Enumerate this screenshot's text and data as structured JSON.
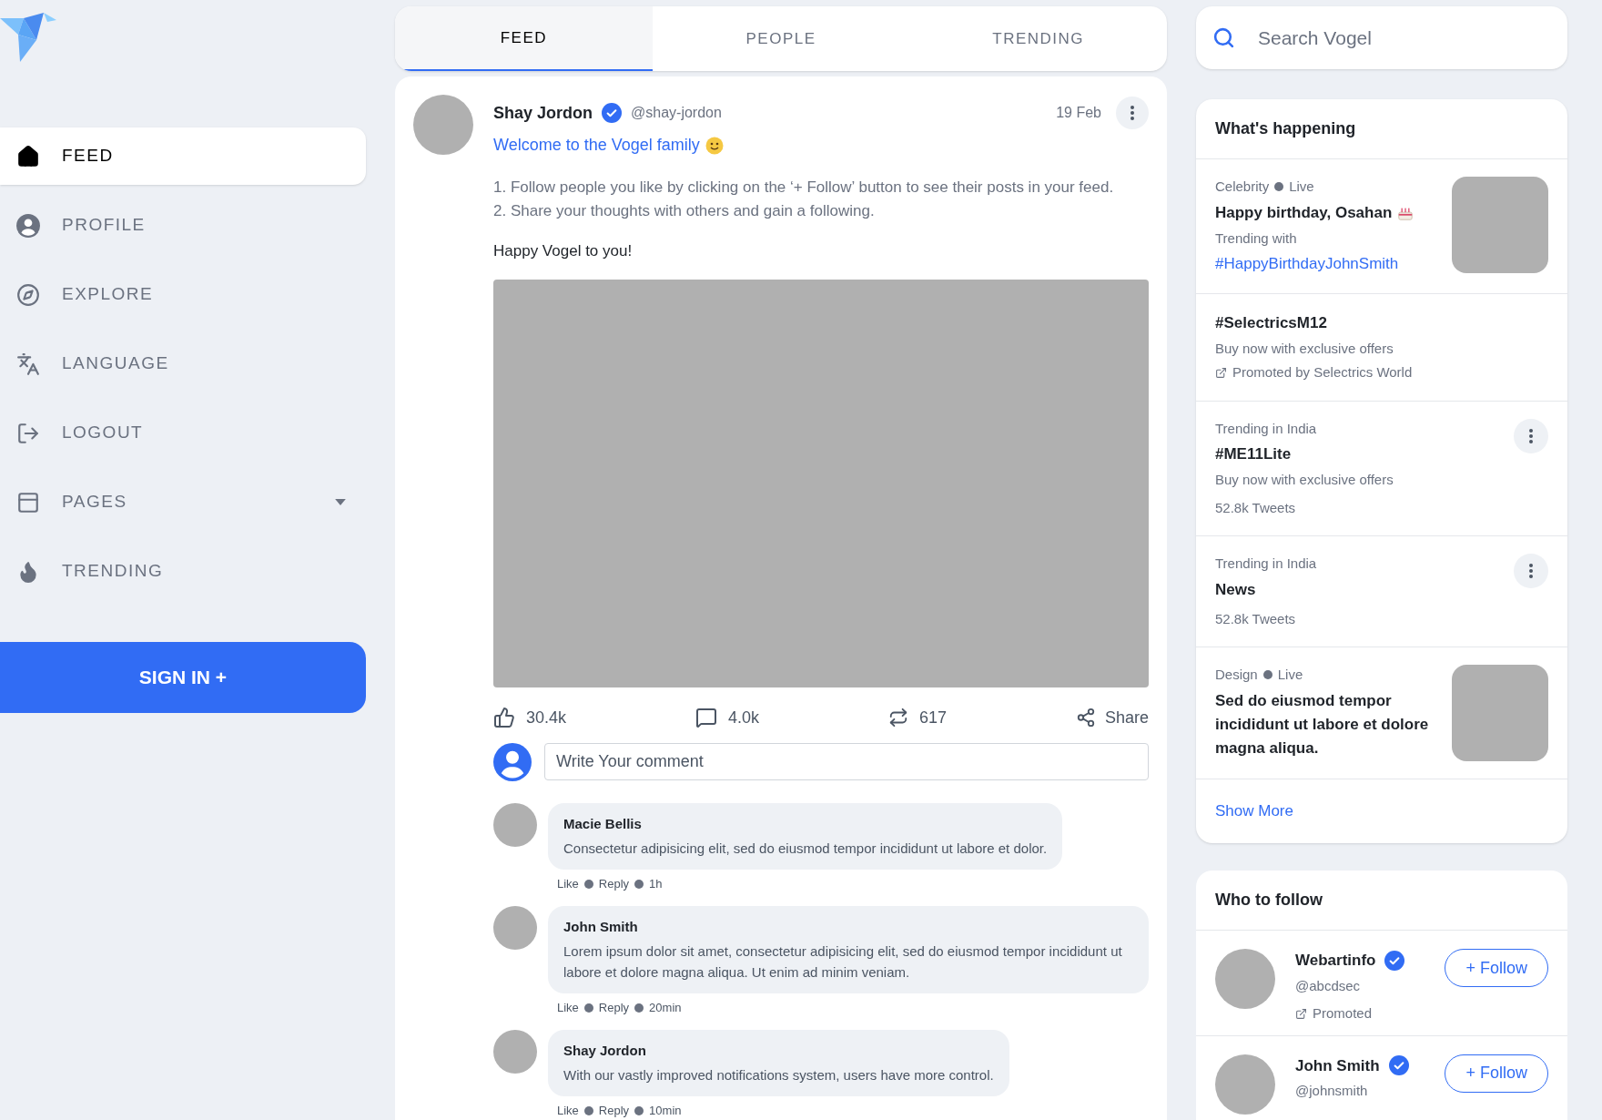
{
  "nav": {
    "items": [
      {
        "label": "FEED",
        "selected": true,
        "kind": "link"
      },
      {
        "label": "PROFILE",
        "selected": false,
        "kind": "link"
      },
      {
        "label": "EXPLORE",
        "selected": false,
        "kind": "link"
      },
      {
        "label": "LANGUAGE",
        "selected": false,
        "kind": "link"
      },
      {
        "label": "LOGOUT",
        "selected": false,
        "kind": "link"
      },
      {
        "label": "PAGES",
        "selected": false,
        "kind": "dropdown"
      },
      {
        "label": "TRENDING",
        "selected": false,
        "kind": "link"
      }
    ],
    "sign_in": "SIGN IN +"
  },
  "tabs": [
    {
      "label": "FEED",
      "selected": true
    },
    {
      "label": "PEOPLE",
      "selected": false
    },
    {
      "label": "TRENDING",
      "selected": false
    }
  ],
  "post": {
    "author": "Shay Jordon",
    "verified": true,
    "handle": "@shay-jordon",
    "date": "19 Feb",
    "headline": "Welcome to the Vogel family",
    "lines": [
      "1. Follow people you like by clicking on the ‘+ Follow’ button to see their posts in your feed.",
      "2. Share your thoughts with others and gain a following."
    ],
    "closing": "Happy Vogel to you!",
    "likes": "30.4k",
    "comments": "4.0k",
    "reposts": "617",
    "share": "Share",
    "comment_field": {
      "placeholder": "Write Your comment"
    },
    "replies": [
      {
        "name": "Macie Bellis",
        "text": "Consectetur adipisicing elit, sed do eiusmod tempor incididunt ut labore et dolor.",
        "like": "Like",
        "reply": "Reply",
        "time": "1h"
      },
      {
        "name": "John Smith",
        "text": "Lorem ipsum dolor sit amet, consectetur adipisicing elit, sed do eiusmod tempor incididunt ut labore et dolore magna aliqua. Ut enim ad minim veniam.",
        "like": "Like",
        "reply": "Reply",
        "time": "20min"
      },
      {
        "name": "Shay Jordon",
        "text": "With our vastly improved notifications system, users have more control.",
        "like": "Like",
        "reply": "Reply",
        "time": "10min"
      }
    ]
  },
  "search": {
    "placeholder": "Search Vogel"
  },
  "happening": {
    "title": "What's happening",
    "items": [
      {
        "kind": "live",
        "category": "Celebrity",
        "status": "Live",
        "title": "Happy birthday, Osahan",
        "subtitle": "Trending with",
        "hashtag": "#HappyBirthdayJohnSmith"
      },
      {
        "kind": "promoted",
        "title": "#SelectricsM12",
        "subtitle": "Buy now with exclusive offers",
        "promoted": "Promoted by Selectrics World"
      },
      {
        "kind": "trend",
        "category": "Trending in India",
        "title": "#ME11Lite",
        "subtitle": "Buy now with exclusive offers",
        "count": "52.8k Tweets"
      },
      {
        "kind": "trend",
        "category": "Trending in India",
        "title": "News",
        "count": "52.8k Tweets"
      },
      {
        "kind": "live",
        "category": "Design",
        "status": "Live",
        "title": "Sed do eiusmod tempor incididunt ut labore et dolore magna aliqua."
      }
    ],
    "show_more": "Show More"
  },
  "who_to_follow": {
    "title": "Who to follow",
    "people": [
      {
        "name": "Webartinfo",
        "verified": true,
        "handle": "@abcdsec",
        "promoted": "Promoted",
        "button": "+ Follow"
      },
      {
        "name": "John Smith",
        "verified": true,
        "handle": "@johnsmith",
        "button": "+ Follow"
      }
    ]
  }
}
